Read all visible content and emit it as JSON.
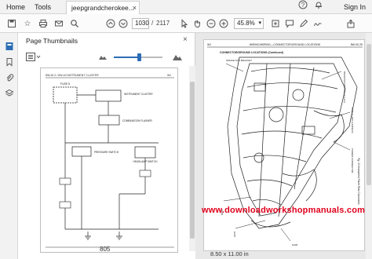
{
  "tabs": {
    "home": "Home",
    "tools": "Tools",
    "document": "jeepgrandcherokee...",
    "close": "×"
  },
  "account": {
    "signin": "Sign In"
  },
  "toolbar": {
    "current_page": "1030",
    "page_separator": "/",
    "total_pages": "2117",
    "zoom": "45.8%"
  },
  "panel": {
    "title": "Page Thumbnails",
    "close": "×",
    "thumbnail_label": "805"
  },
  "document": {
    "watermark": "www.downloadworkshopmanuals.com",
    "page_size": "8.50 x 11.00 in",
    "header_left": "WJ",
    "header_center": "WIRING/WIRING—CONNECTOR/GROUND LOCATIONS",
    "header_right": "8W-90-25",
    "subtitle": "CONNECTOR/GROUND LOCATIONS (Continued)",
    "figure_caption": "Fig. 23 Instrument Panel Rear Connectors",
    "callouts": [
      "SMOKE OUT BRACKET",
      "BOOSTER MODULE (C1-C3)",
      "CABLE LINK HARNESS",
      "POWER CONNECTOR",
      "C206",
      "C215",
      "G200"
    ]
  },
  "schematic": {
    "header_left": "8W-40-2 / 8W-40 INSTRUMENT CLUSTER",
    "header_right": "WJ",
    "labels": [
      "FUSE 5",
      "INSTRUMENT CLUSTER",
      "COMBINATION FLASHER",
      "PRESSURE SWITCH",
      "HEADLAMP SWITCH"
    ]
  }
}
